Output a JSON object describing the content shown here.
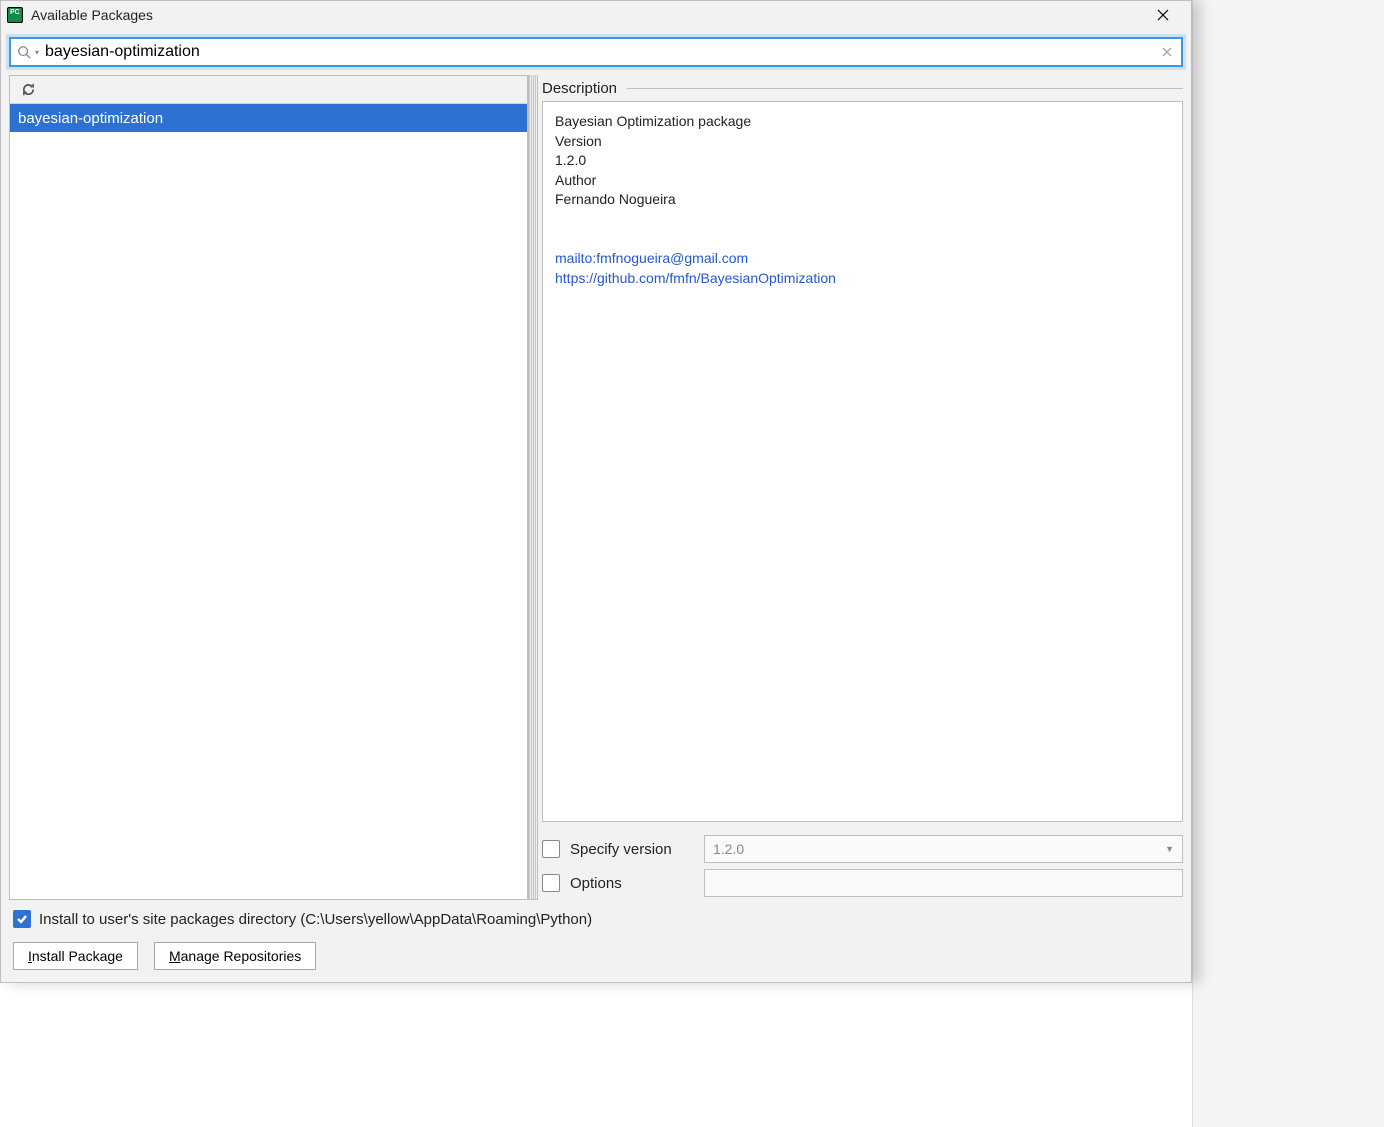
{
  "window": {
    "title": "Available Packages"
  },
  "search": {
    "value": "bayesian-optimization"
  },
  "package_list": {
    "items": [
      {
        "name": "bayesian-optimization",
        "selected": true
      }
    ]
  },
  "description": {
    "heading": "Description",
    "summary": "Bayesian Optimization package",
    "version_label": "Version",
    "version": "1.2.0",
    "author_label": "Author",
    "author": "Fernando Nogueira",
    "mailto": "mailto:fmfnogueira@gmail.com",
    "homepage": "https://github.com/fmfn/BayesianOptimization"
  },
  "options": {
    "specify_version_checked": false,
    "specify_version_label": "Specify version",
    "specify_version_value": "1.2.0",
    "options_checked": false,
    "options_label": "Options",
    "options_value": ""
  },
  "install_to_user": {
    "checked": true,
    "label": "Install to user's site packages directory (C:\\Users\\yellow\\AppData\\Roaming\\Python)"
  },
  "buttons": {
    "install": "Install Package",
    "manage": "Manage Repositories"
  }
}
